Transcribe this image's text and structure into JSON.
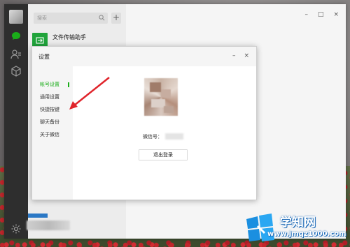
{
  "main_window": {
    "search_placeholder": "搜索",
    "add_button": "+",
    "chat_list": [
      {
        "name": "文件传输助手"
      }
    ],
    "window_controls": {
      "minimize": "–",
      "maximize": "□",
      "close": "×"
    }
  },
  "settings_dialog": {
    "title": "设置",
    "controls": {
      "minimize": "–",
      "close": "×"
    },
    "nav": [
      {
        "label": "帐号设置",
        "active": true
      },
      {
        "label": "通用设置",
        "active": false
      },
      {
        "label": "快捷按键",
        "active": false
      },
      {
        "label": "聊天备份",
        "active": false
      },
      {
        "label": "关于微信",
        "active": false
      }
    ],
    "wechat_id_label": "微信号：",
    "logout_button": "退出登录"
  },
  "watermark": {
    "title": "学知网",
    "url": "www.jmqz1000.com"
  },
  "colors": {
    "accent_green": "#1aad19",
    "sidebar_dark": "#2e2e2e",
    "arrow_red": "#e0242b"
  }
}
